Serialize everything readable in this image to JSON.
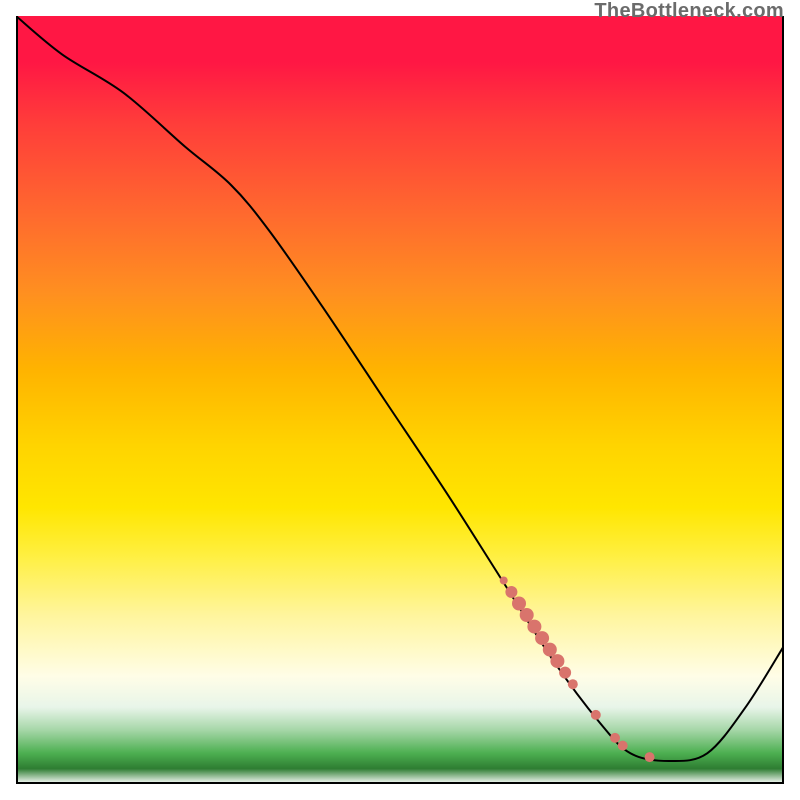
{
  "watermark": "TheBottleneck.com",
  "colors": {
    "curve_stroke": "#000000",
    "marker_fill": "#d9746c",
    "marker_stroke": "#c25a52"
  },
  "chart_data": {
    "type": "line",
    "title": "",
    "xlabel": "",
    "ylabel": "",
    "xlim": [
      0,
      100
    ],
    "ylim": [
      0,
      100
    ],
    "grid": false,
    "legend": false,
    "curve": [
      {
        "x": 0,
        "y": 100
      },
      {
        "x": 6,
        "y": 95
      },
      {
        "x": 14,
        "y": 90
      },
      {
        "x": 22,
        "y": 83
      },
      {
        "x": 28,
        "y": 78
      },
      {
        "x": 33,
        "y": 72
      },
      {
        "x": 40,
        "y": 62
      },
      {
        "x": 48,
        "y": 50
      },
      {
        "x": 56,
        "y": 38
      },
      {
        "x": 63,
        "y": 27
      },
      {
        "x": 70,
        "y": 16
      },
      {
        "x": 76,
        "y": 8
      },
      {
        "x": 80,
        "y": 4
      },
      {
        "x": 85,
        "y": 3
      },
      {
        "x": 90,
        "y": 4
      },
      {
        "x": 95,
        "y": 10
      },
      {
        "x": 100,
        "y": 18
      }
    ],
    "markers": [
      {
        "x": 63.5,
        "y": 26.5,
        "r": 4
      },
      {
        "x": 64.5,
        "y": 25.0,
        "r": 6
      },
      {
        "x": 65.5,
        "y": 23.5,
        "r": 7
      },
      {
        "x": 66.5,
        "y": 22.0,
        "r": 7
      },
      {
        "x": 67.5,
        "y": 20.5,
        "r": 7
      },
      {
        "x": 68.5,
        "y": 19.0,
        "r": 7
      },
      {
        "x": 69.5,
        "y": 17.5,
        "r": 7
      },
      {
        "x": 70.5,
        "y": 16.0,
        "r": 7
      },
      {
        "x": 71.5,
        "y": 14.5,
        "r": 6
      },
      {
        "x": 72.5,
        "y": 13.0,
        "r": 5
      },
      {
        "x": 75.5,
        "y": 9.0,
        "r": 5
      },
      {
        "x": 78.0,
        "y": 6.0,
        "r": 5
      },
      {
        "x": 79.0,
        "y": 5.0,
        "r": 5
      },
      {
        "x": 82.5,
        "y": 3.5,
        "r": 5
      }
    ]
  }
}
